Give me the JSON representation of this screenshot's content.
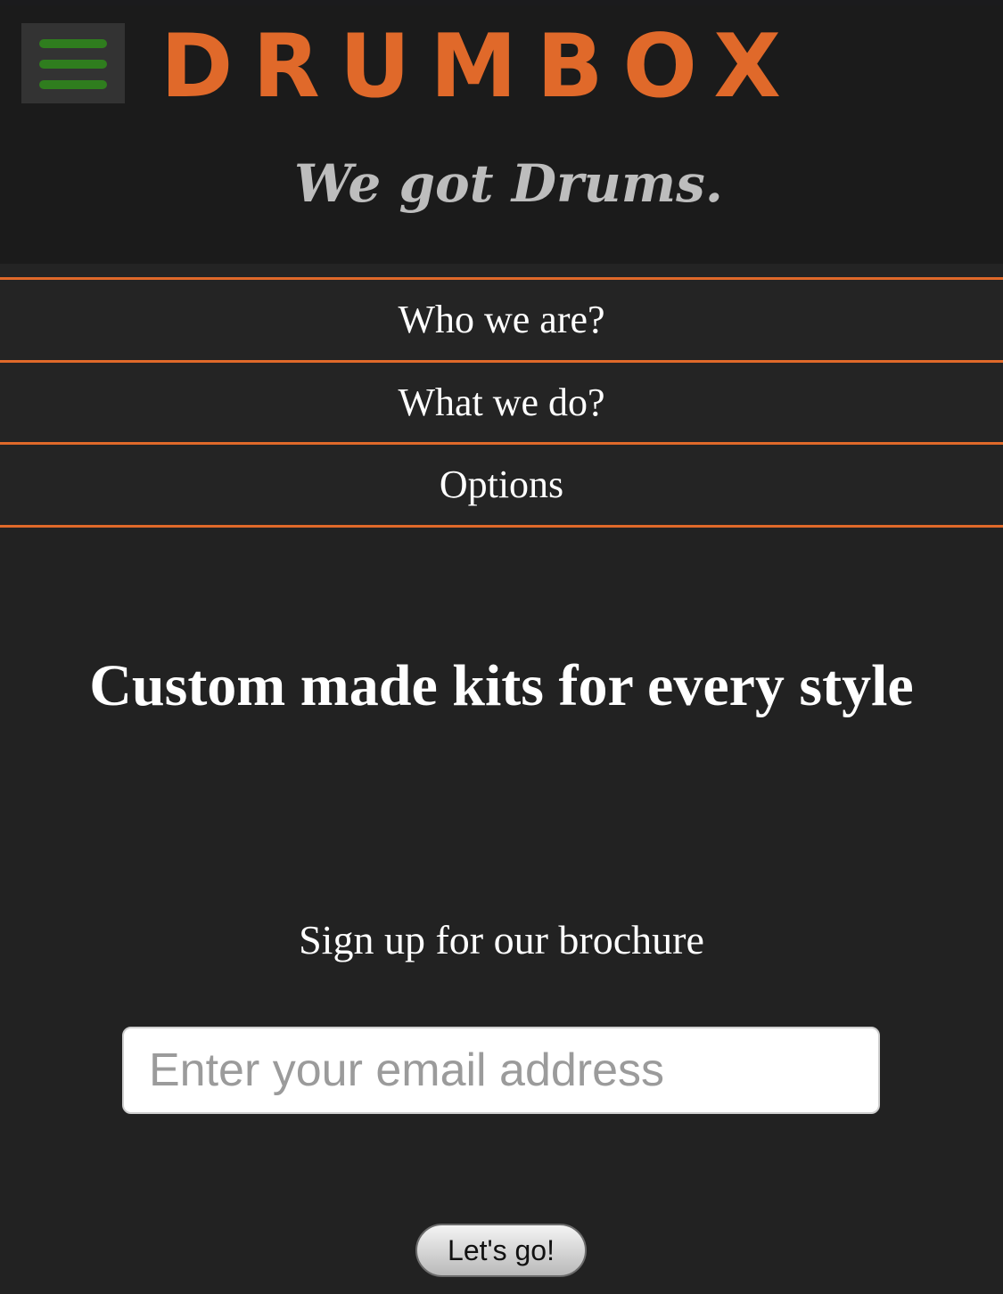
{
  "header": {
    "logo_text": "DRUMBOX",
    "tagline": "We got Drums.",
    "menu_icon": "hamburger-menu-icon"
  },
  "nav": {
    "items": [
      {
        "label": "Who we are?"
      },
      {
        "label": "What we do?"
      },
      {
        "label": "Options"
      }
    ]
  },
  "main": {
    "headline": "Custom made kits for every style",
    "subhead": "Sign up for our brochure",
    "email_placeholder": "Enter your email address",
    "submit_label": "Let's go!"
  },
  "colors": {
    "background": "#222222",
    "header_background": "#1b1b1b",
    "accent_orange": "#e0692a",
    "menu_green": "#2f7d1e",
    "tagline_gray": "#bdbdbd"
  }
}
